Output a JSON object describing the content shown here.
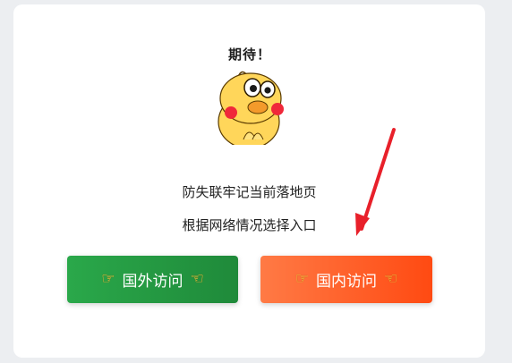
{
  "mascot": {
    "caption": "期待！"
  },
  "message": {
    "line1": "防失联牢记当前落地页",
    "line2": "根据网络情况选择入口"
  },
  "buttons": {
    "international": {
      "label": "国外访问",
      "left_icon": "pointing-hand-right-icon",
      "right_icon": "pointing-hand-left-icon",
      "color_start": "#2aa84a",
      "color_end": "#1f8a3a"
    },
    "domestic": {
      "label": "国内访问",
      "left_icon": "pointing-hand-right-icon",
      "right_icon": "pointing-hand-left-icon",
      "color_start": "#ff7a45",
      "color_end": "#ff4a12"
    }
  },
  "annotation": {
    "arrow_color": "#e8202a"
  }
}
